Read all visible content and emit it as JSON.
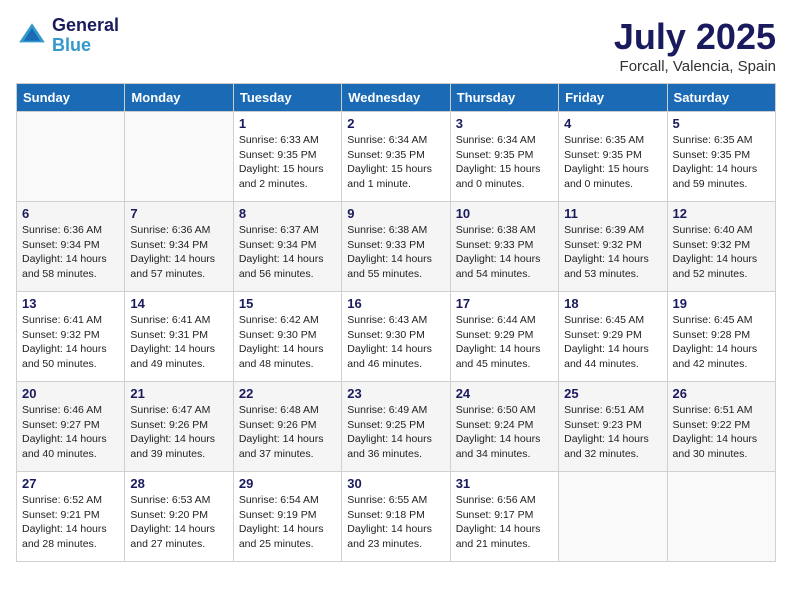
{
  "header": {
    "logo_line1": "General",
    "logo_line2": "Blue",
    "month": "July 2025",
    "location": "Forcall, Valencia, Spain"
  },
  "columns": [
    "Sunday",
    "Monday",
    "Tuesday",
    "Wednesday",
    "Thursday",
    "Friday",
    "Saturday"
  ],
  "weeks": [
    [
      {
        "day": "",
        "info": ""
      },
      {
        "day": "",
        "info": ""
      },
      {
        "day": "1",
        "info": "Sunrise: 6:33 AM\nSunset: 9:35 PM\nDaylight: 15 hours\nand 2 minutes."
      },
      {
        "day": "2",
        "info": "Sunrise: 6:34 AM\nSunset: 9:35 PM\nDaylight: 15 hours\nand 1 minute."
      },
      {
        "day": "3",
        "info": "Sunrise: 6:34 AM\nSunset: 9:35 PM\nDaylight: 15 hours\nand 0 minutes."
      },
      {
        "day": "4",
        "info": "Sunrise: 6:35 AM\nSunset: 9:35 PM\nDaylight: 15 hours\nand 0 minutes."
      },
      {
        "day": "5",
        "info": "Sunrise: 6:35 AM\nSunset: 9:35 PM\nDaylight: 14 hours\nand 59 minutes."
      }
    ],
    [
      {
        "day": "6",
        "info": "Sunrise: 6:36 AM\nSunset: 9:34 PM\nDaylight: 14 hours\nand 58 minutes."
      },
      {
        "day": "7",
        "info": "Sunrise: 6:36 AM\nSunset: 9:34 PM\nDaylight: 14 hours\nand 57 minutes."
      },
      {
        "day": "8",
        "info": "Sunrise: 6:37 AM\nSunset: 9:34 PM\nDaylight: 14 hours\nand 56 minutes."
      },
      {
        "day": "9",
        "info": "Sunrise: 6:38 AM\nSunset: 9:33 PM\nDaylight: 14 hours\nand 55 minutes."
      },
      {
        "day": "10",
        "info": "Sunrise: 6:38 AM\nSunset: 9:33 PM\nDaylight: 14 hours\nand 54 minutes."
      },
      {
        "day": "11",
        "info": "Sunrise: 6:39 AM\nSunset: 9:32 PM\nDaylight: 14 hours\nand 53 minutes."
      },
      {
        "day": "12",
        "info": "Sunrise: 6:40 AM\nSunset: 9:32 PM\nDaylight: 14 hours\nand 52 minutes."
      }
    ],
    [
      {
        "day": "13",
        "info": "Sunrise: 6:41 AM\nSunset: 9:32 PM\nDaylight: 14 hours\nand 50 minutes."
      },
      {
        "day": "14",
        "info": "Sunrise: 6:41 AM\nSunset: 9:31 PM\nDaylight: 14 hours\nand 49 minutes."
      },
      {
        "day": "15",
        "info": "Sunrise: 6:42 AM\nSunset: 9:30 PM\nDaylight: 14 hours\nand 48 minutes."
      },
      {
        "day": "16",
        "info": "Sunrise: 6:43 AM\nSunset: 9:30 PM\nDaylight: 14 hours\nand 46 minutes."
      },
      {
        "day": "17",
        "info": "Sunrise: 6:44 AM\nSunset: 9:29 PM\nDaylight: 14 hours\nand 45 minutes."
      },
      {
        "day": "18",
        "info": "Sunrise: 6:45 AM\nSunset: 9:29 PM\nDaylight: 14 hours\nand 44 minutes."
      },
      {
        "day": "19",
        "info": "Sunrise: 6:45 AM\nSunset: 9:28 PM\nDaylight: 14 hours\nand 42 minutes."
      }
    ],
    [
      {
        "day": "20",
        "info": "Sunrise: 6:46 AM\nSunset: 9:27 PM\nDaylight: 14 hours\nand 40 minutes."
      },
      {
        "day": "21",
        "info": "Sunrise: 6:47 AM\nSunset: 9:26 PM\nDaylight: 14 hours\nand 39 minutes."
      },
      {
        "day": "22",
        "info": "Sunrise: 6:48 AM\nSunset: 9:26 PM\nDaylight: 14 hours\nand 37 minutes."
      },
      {
        "day": "23",
        "info": "Sunrise: 6:49 AM\nSunset: 9:25 PM\nDaylight: 14 hours\nand 36 minutes."
      },
      {
        "day": "24",
        "info": "Sunrise: 6:50 AM\nSunset: 9:24 PM\nDaylight: 14 hours\nand 34 minutes."
      },
      {
        "day": "25",
        "info": "Sunrise: 6:51 AM\nSunset: 9:23 PM\nDaylight: 14 hours\nand 32 minutes."
      },
      {
        "day": "26",
        "info": "Sunrise: 6:51 AM\nSunset: 9:22 PM\nDaylight: 14 hours\nand 30 minutes."
      }
    ],
    [
      {
        "day": "27",
        "info": "Sunrise: 6:52 AM\nSunset: 9:21 PM\nDaylight: 14 hours\nand 28 minutes."
      },
      {
        "day": "28",
        "info": "Sunrise: 6:53 AM\nSunset: 9:20 PM\nDaylight: 14 hours\nand 27 minutes."
      },
      {
        "day": "29",
        "info": "Sunrise: 6:54 AM\nSunset: 9:19 PM\nDaylight: 14 hours\nand 25 minutes."
      },
      {
        "day": "30",
        "info": "Sunrise: 6:55 AM\nSunset: 9:18 PM\nDaylight: 14 hours\nand 23 minutes."
      },
      {
        "day": "31",
        "info": "Sunrise: 6:56 AM\nSunset: 9:17 PM\nDaylight: 14 hours\nand 21 minutes."
      },
      {
        "day": "",
        "info": ""
      },
      {
        "day": "",
        "info": ""
      }
    ]
  ]
}
